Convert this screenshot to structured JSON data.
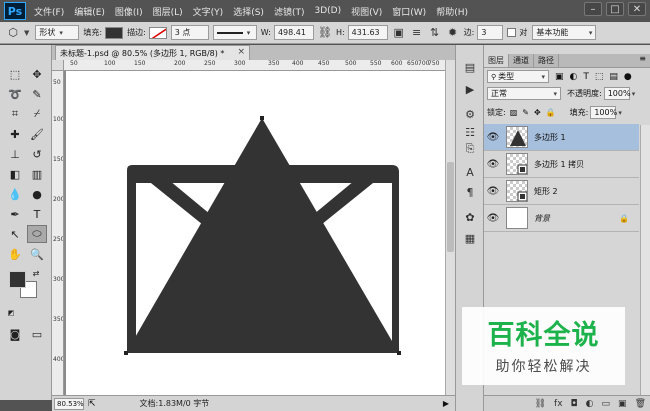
{
  "app": {
    "logo": "Ps"
  },
  "menu": [
    "文件(F)",
    "编辑(E)",
    "图像(I)",
    "图层(L)",
    "文字(Y)",
    "选择(S)",
    "滤镜(T)",
    "3D(D)",
    "视图(V)",
    "窗口(W)",
    "帮助(H)"
  ],
  "window_controls": {
    "minimize": "–",
    "maximize": "□",
    "close": "✕"
  },
  "options": {
    "mode": "形状",
    "fill_label": "填充:",
    "stroke_label": "描边:",
    "stroke_width": "3 点",
    "w_label": "W:",
    "w_value": "498.41",
    "h_label": "H:",
    "h_value": "431.63",
    "edges_label": "边:",
    "edges_value": "3",
    "workspace": "基本功能"
  },
  "document": {
    "tab_title": "未标题-1.psd @ 80.5% (多边形 1, RGB/8) *",
    "close": "×",
    "ruler_top": [
      "50",
      "100",
      "150",
      "200",
      "250",
      "300",
      "350",
      "400",
      "450",
      "500",
      "550",
      "600",
      "650",
      "700",
      "750"
    ],
    "ruler_left": [
      "50",
      "100",
      "150",
      "200",
      "250",
      "300",
      "350",
      "400"
    ]
  },
  "status": {
    "zoom": "80.53%",
    "doc_info": "文档:1.83M/0 字节"
  },
  "layers_panel": {
    "tabs": [
      "图层",
      "通道",
      "路径"
    ],
    "filter_kind": "类型",
    "blend_mode": "正常",
    "opacity_label": "不透明度:",
    "opacity_value": "100%",
    "lock_label": "锁定:",
    "fill_label": "填充:",
    "fill_value": "100%",
    "layers": [
      {
        "name": "多边形 1",
        "selected": true
      },
      {
        "name": "多边形 1 拷贝",
        "selected": false
      },
      {
        "name": "矩形 2",
        "selected": false
      },
      {
        "name": "背景",
        "selected": false
      }
    ]
  },
  "watermark": {
    "title": "百科全说",
    "subtitle": "助你轻松解决"
  },
  "colors": {
    "shape_fill": "#333333",
    "selection_highlight": "#a6bfdc",
    "watermark_green": "#1db34c"
  }
}
